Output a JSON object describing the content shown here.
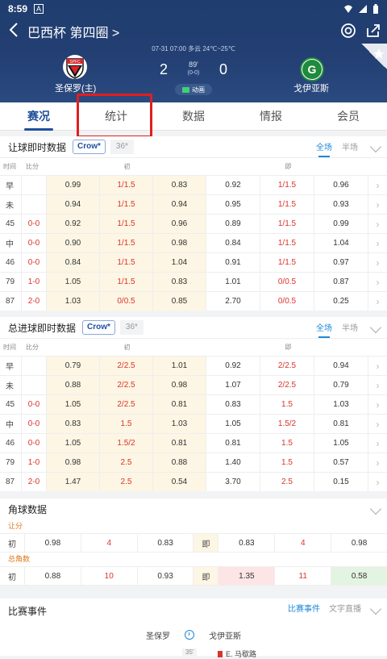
{
  "status_bar": {
    "time": "8:59",
    "a_label": "A"
  },
  "header": {
    "title": "巴西杯 第四圈 >",
    "meta": "07-31 07:00  多云 24℃~25℃",
    "home_team": "圣保罗(主)",
    "away_team": "戈伊亚斯",
    "home_score": "2",
    "away_score": "0",
    "minute": "89'",
    "half_score": "(0-0)",
    "animation_label": "动画",
    "home_logo_text": "SPFC",
    "away_logo_text": "G"
  },
  "tabs": [
    "赛况",
    "统计",
    "数据",
    "情报",
    "会员"
  ],
  "handicap": {
    "title": "让球即时数据",
    "company": "Crow*",
    "alt_company": "36*",
    "scope_full": "全场",
    "scope_half": "半场",
    "hdr_time": "时间",
    "hdr_score": "比分",
    "hdr_initial": "初",
    "hdr_live": "即",
    "rows": [
      {
        "t": "早",
        "s": "",
        "a1": "0.99",
        "a2": "1/1.5",
        "a3": "0.83",
        "b1": "0.92",
        "b2": "1/1.5",
        "b3": "0.96",
        "tc": "green"
      },
      {
        "t": "未",
        "s": "",
        "a1": "0.94",
        "a2": "1/1.5",
        "a3": "0.94",
        "b1": "0.95",
        "b2": "1/1.5",
        "b3": "0.93",
        "tc": "red"
      },
      {
        "t": "45",
        "s": "0-0",
        "a1": "0.92",
        "a2": "1/1.5",
        "a3": "0.96",
        "b1": "0.89",
        "b2": "1/1.5",
        "b3": "0.99",
        "tc": ""
      },
      {
        "t": "中",
        "s": "0-0",
        "a1": "0.90",
        "a2": "1/1.5",
        "a3": "0.98",
        "b1": "0.84",
        "b2": "1/1.5",
        "b3": "1.04",
        "tc": "blue"
      },
      {
        "t": "46",
        "s": "0-0",
        "a1": "0.84",
        "a2": "1/1.5",
        "a3": "1.04",
        "b1": "0.91",
        "b2": "1/1.5",
        "b3": "0.97",
        "tc": ""
      },
      {
        "t": "79",
        "s": "1-0",
        "a1": "1.05",
        "a2": "1/1.5",
        "a3": "0.83",
        "b1": "1.01",
        "b2": "0/0.5",
        "b3": "0.87",
        "tc": ""
      },
      {
        "t": "87",
        "s": "2-0",
        "a1": "1.03",
        "a2": "0/0.5",
        "a3": "0.85",
        "b1": "2.70",
        "b2": "0/0.5",
        "b3": "0.25",
        "tc": ""
      }
    ]
  },
  "goals": {
    "title": "总进球即时数据",
    "company": "Crow*",
    "alt_company": "36*",
    "scope_full": "全场",
    "scope_half": "半场",
    "hdr_time": "时间",
    "hdr_score": "比分",
    "hdr_initial": "初",
    "hdr_live": "即",
    "rows": [
      {
        "t": "早",
        "s": "",
        "a1": "0.79",
        "a2": "2/2.5",
        "a3": "1.01",
        "b1": "0.92",
        "b2": "2/2.5",
        "b3": "0.94",
        "tc": "green"
      },
      {
        "t": "未",
        "s": "",
        "a1": "0.88",
        "a2": "2/2.5",
        "a3": "0.98",
        "b1": "1.07",
        "b2": "2/2.5",
        "b3": "0.79",
        "tc": "red"
      },
      {
        "t": "45",
        "s": "0-0",
        "a1": "1.05",
        "a2": "2/2.5",
        "a3": "0.81",
        "b1": "0.83",
        "b2": "1.5",
        "b3": "1.03",
        "tc": ""
      },
      {
        "t": "中",
        "s": "0-0",
        "a1": "0.83",
        "a2": "1.5",
        "a3": "1.03",
        "b1": "1.05",
        "b2": "1.5/2",
        "b3": "0.81",
        "tc": "blue"
      },
      {
        "t": "46",
        "s": "0-0",
        "a1": "1.05",
        "a2": "1.5/2",
        "a3": "0.81",
        "b1": "0.81",
        "b2": "1.5",
        "b3": "1.05",
        "tc": ""
      },
      {
        "t": "79",
        "s": "1-0",
        "a1": "0.98",
        "a2": "2.5",
        "a3": "0.88",
        "b1": "1.40",
        "b2": "1.5",
        "b3": "0.57",
        "tc": ""
      },
      {
        "t": "87",
        "s": "2-0",
        "a1": "1.47",
        "a2": "2.5",
        "a3": "0.54",
        "b1": "3.70",
        "b2": "2.5",
        "b3": "0.15",
        "tc": ""
      }
    ]
  },
  "corners": {
    "title": "角球数据",
    "handicap_label": "让分",
    "total_label": "总角数",
    "initial_label": "初",
    "live_label": "即",
    "handicap_row": [
      "0.98",
      "4",
      "0.83",
      "0.83",
      "4",
      "0.98"
    ],
    "total_row": [
      "0.88",
      "10",
      "0.93",
      "1.35",
      "11",
      "0.58"
    ]
  },
  "events": {
    "title": "比赛事件",
    "tab_events": "比赛事件",
    "tab_text": "文字直播",
    "home": "圣保罗",
    "away": "戈伊亚斯",
    "first_minute": "35'",
    "first_player": "E. 马歇路"
  },
  "colors": {
    "header_bg": "#233f73",
    "accent": "#1e4f9c",
    "red": "#d9342b",
    "highlight_box": "#e11f1f"
  }
}
